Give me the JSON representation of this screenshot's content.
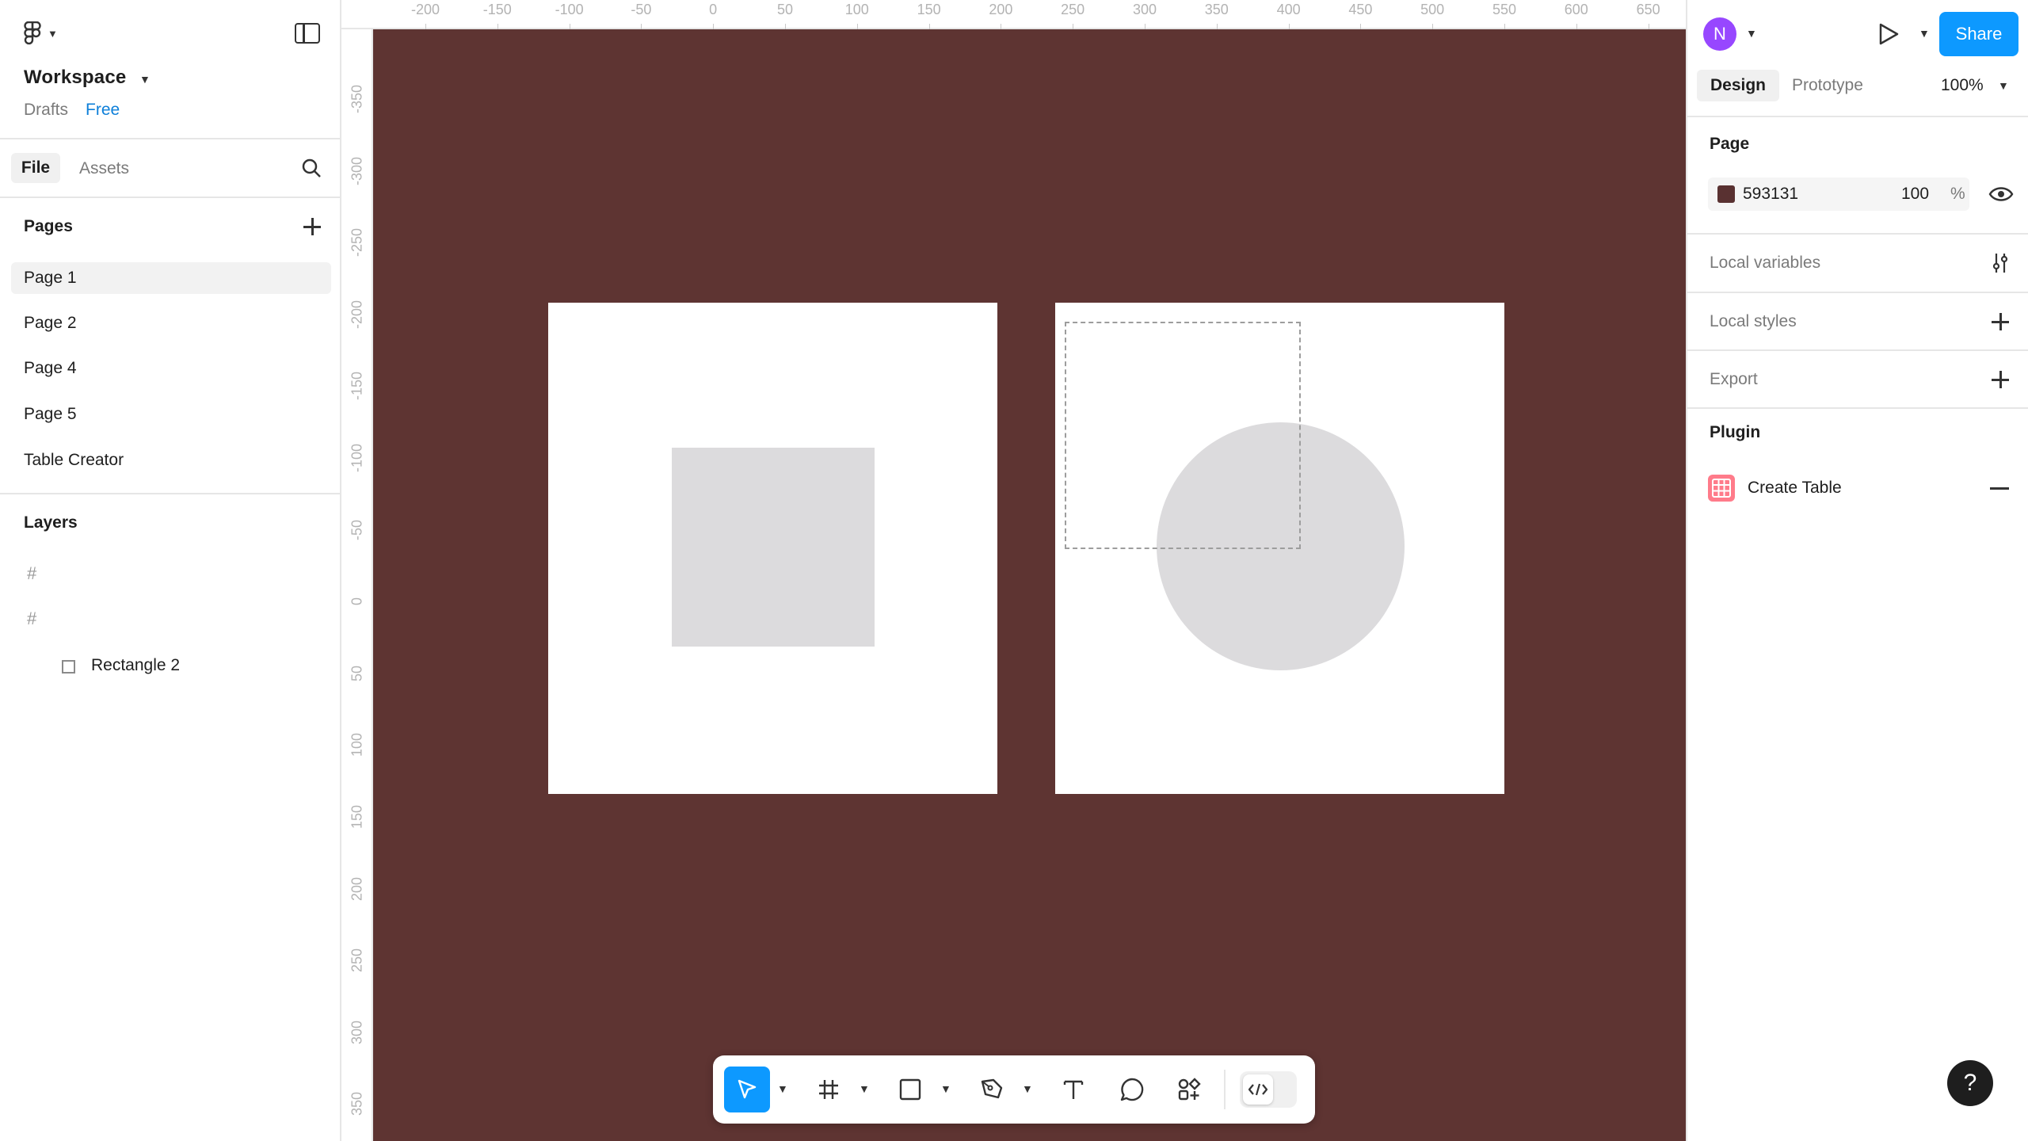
{
  "workspace": {
    "name": "Workspace",
    "drafts_label": "Drafts",
    "plan_label": "Free"
  },
  "left_tabs": {
    "file": "File",
    "assets": "Assets"
  },
  "pages": {
    "title": "Pages",
    "items": [
      "Page 1",
      "Page 2",
      "Page 4",
      "Page 5",
      "Table Creator"
    ],
    "selected": "Page 1"
  },
  "layers": {
    "title": "Layers",
    "items": [
      {
        "icon": "frame-icon",
        "label": ""
      },
      {
        "icon": "frame-icon",
        "label": ""
      },
      {
        "icon": "rectangle-icon",
        "label": "Rectangle 2"
      }
    ]
  },
  "ruler": {
    "top": [
      "-200",
      "-150",
      "-100",
      "-50",
      "0",
      "50",
      "100",
      "150",
      "200",
      "250",
      "300",
      "350",
      "400",
      "450",
      "500",
      "550",
      "600",
      "650"
    ],
    "left": [
      "-350",
      "-300",
      "-250",
      "-200",
      "-150",
      "-100",
      "-50",
      "0",
      "50",
      "100",
      "150",
      "200",
      "250",
      "300",
      "350"
    ]
  },
  "canvas": {
    "background": "#5e3432",
    "shape_fill": "#dcdbdd"
  },
  "toolbar": {
    "tools": [
      "move-tool",
      "frame-tool",
      "shape-tool",
      "pen-tool",
      "text-tool",
      "comment-tool",
      "actions-tool",
      "dev-mode-toggle"
    ],
    "active_tool": "move-tool",
    "accent": "#0d99ff"
  },
  "header_right": {
    "avatar_initial": "N",
    "share_label": "Share"
  },
  "right_tabs": {
    "design": "Design",
    "prototype": "Prototype",
    "zoom": "100%"
  },
  "page_section": {
    "title": "Page",
    "color_hex": "593131",
    "swatch": "#593131",
    "opacity": "100",
    "opacity_unit": "%"
  },
  "sections": {
    "local_variables": "Local variables",
    "local_styles": "Local styles",
    "export": "Export"
  },
  "plugin": {
    "title": "Plugin",
    "name": "Create Table"
  },
  "help": {
    "label": "?"
  }
}
